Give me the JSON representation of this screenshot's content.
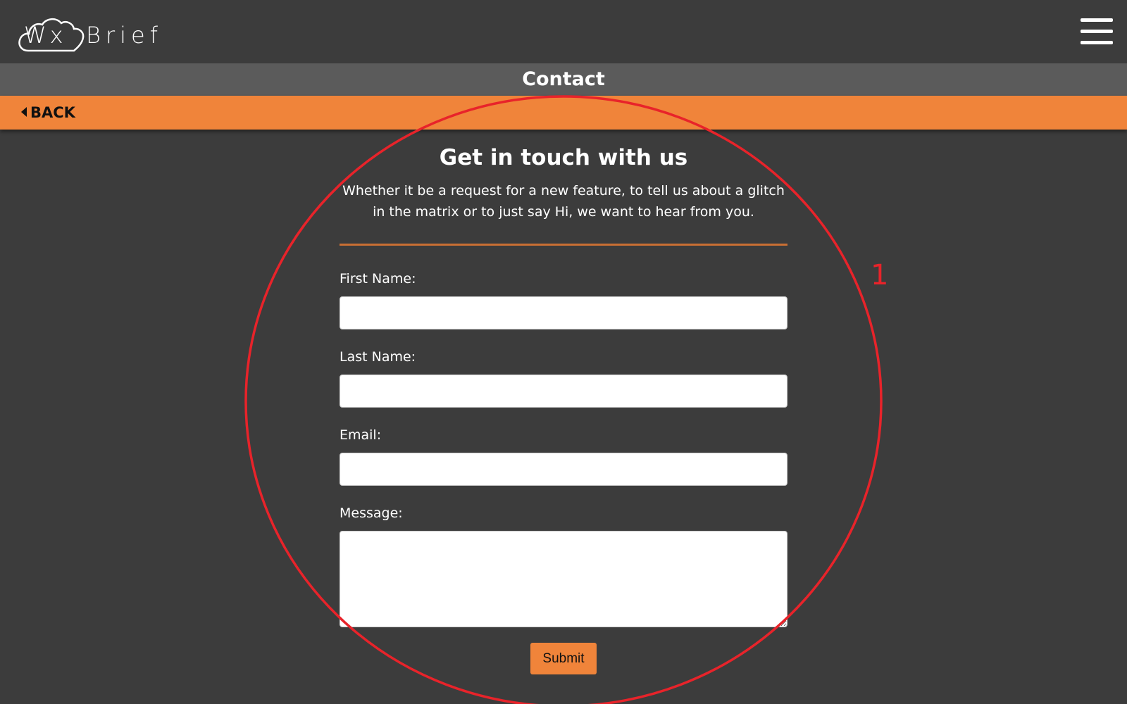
{
  "header": {
    "logo_wx": "Wx",
    "logo_brief": "Brief",
    "menu_icon": "hamburger-menu-icon"
  },
  "title_bar": {
    "title": "Contact"
  },
  "nav": {
    "back_label": "BACK",
    "back_icon": "caret-left-icon"
  },
  "form": {
    "heading": "Get in touch with us",
    "intro": "Whether it be a request for a new feature, to tell us about a glitch in the matrix or to just say Hi, we want to hear from you.",
    "first_name_label": "First Name:",
    "first_name_value": "",
    "last_name_label": "Last Name:",
    "last_name_value": "",
    "email_label": "Email:",
    "email_value": "",
    "message_label": "Message:",
    "message_value": "",
    "submit_label": "Submit"
  },
  "annotation": {
    "label": "1",
    "color": "#e8232a"
  },
  "colors": {
    "background": "#3c3c3c",
    "title_bar": "#5b5b5b",
    "accent": "#f0843a",
    "divider": "#c96f33"
  }
}
